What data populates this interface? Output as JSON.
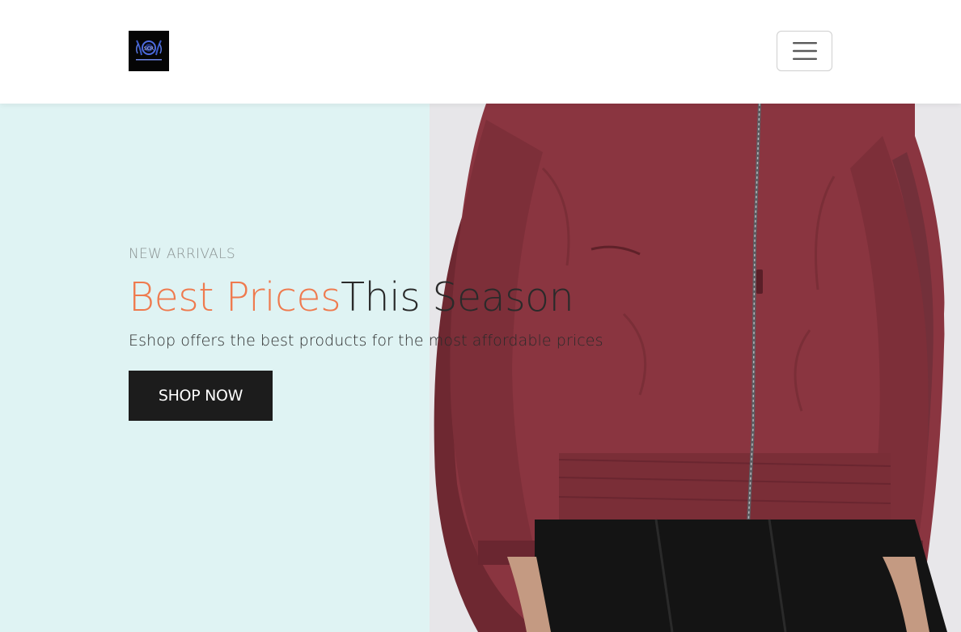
{
  "navbar": {
    "logo_text": "SCR",
    "menu_icon": "hamburger-menu-icon"
  },
  "hero": {
    "eyebrow": "NEW ARRIVALS",
    "headline_accent": "Best Prices",
    "headline_rest": "This Season",
    "subline": "Eshop offers the best products for the most affordable prices",
    "cta_label": "SHOP NOW",
    "image_subject": "model wearing a maroon bomber jacket"
  },
  "colors": {
    "accent": "#ef7a4e",
    "hero_background": "#dff3f3",
    "button": "#1c1c1c",
    "jacket": "#8a3540"
  }
}
